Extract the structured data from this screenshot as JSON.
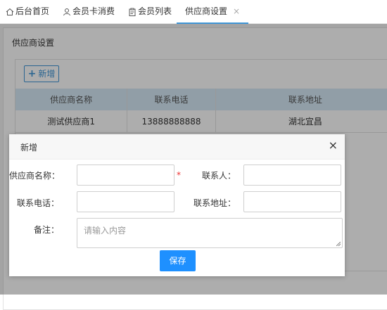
{
  "tabs": [
    {
      "label": "后台首页",
      "icon": "home-icon"
    },
    {
      "label": "会员卡消费",
      "icon": "user-icon"
    },
    {
      "label": "会员列表",
      "icon": "clipboard-icon"
    },
    {
      "label": "供应商设置",
      "icon": "",
      "active": true,
      "closable": true
    }
  ],
  "tab_close_glyph": "×",
  "colors": {
    "accent": "#3e95d6",
    "primary_button": "#1e90ff",
    "required": "#e33333",
    "table_header": "#d6e9f7"
  },
  "page": {
    "title": "供应商设置",
    "add_button": "新增",
    "add_icon": "+"
  },
  "table": {
    "columns": [
      "供应商名称",
      "联系电话",
      "联系地址"
    ],
    "rows": [
      [
        "测试供应商1",
        "13888888888",
        "湖北宜昌"
      ]
    ]
  },
  "dialog": {
    "title": "新增",
    "close_glyph": "×",
    "required_mark": "*",
    "fields": {
      "supplier_name_label": "供应商名称：",
      "contact_person_label": "联系人：",
      "phone_label": "联系电话：",
      "address_label": "联系地址：",
      "remark_label": "备注：",
      "remark_placeholder": "请输入内容"
    },
    "save_label": "保存"
  }
}
